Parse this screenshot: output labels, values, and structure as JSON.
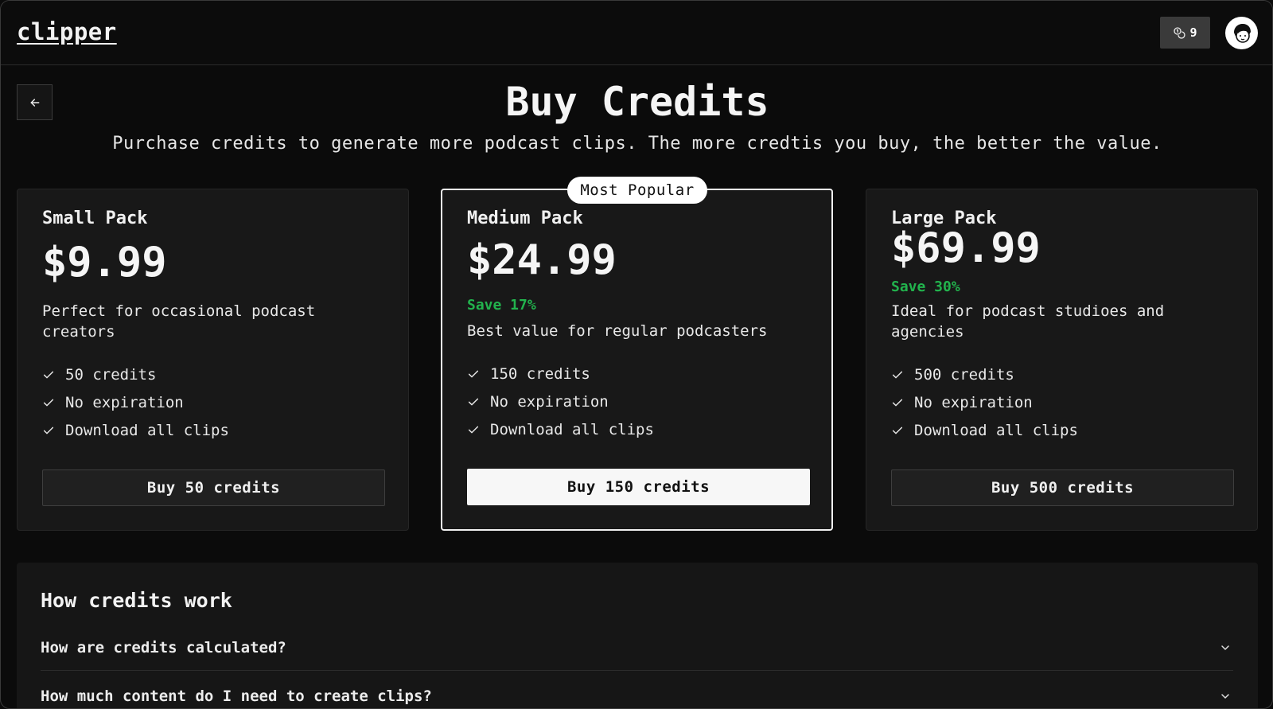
{
  "header": {
    "logo": "clipper",
    "credits_count": "9",
    "credits_icon": "coins-icon",
    "avatar_icon": "user-avatar"
  },
  "back_icon": "arrow-left-icon",
  "page": {
    "title": "Buy Credits",
    "subtitle": "Purchase credits to generate more podcast clips. The more credtis you buy, the better the value."
  },
  "plans": [
    {
      "name": "Small Pack",
      "price": "$9.99",
      "save": "",
      "description": "Perfect for occasional podcast creators",
      "features": [
        "50 credits",
        "No expiration",
        "Download all clips"
      ],
      "button": "Buy 50 credits"
    },
    {
      "badge": "Most Popular",
      "name": "Medium Pack",
      "price": "$24.99",
      "save": "Save 17%",
      "description": "Best value for regular podcasters",
      "features": [
        "150 credits",
        "No expiration",
        "Download all clips"
      ],
      "button": "Buy 150 credits"
    },
    {
      "name": "Large Pack",
      "price": "$69.99",
      "save": "Save 30%",
      "description": "Ideal for podcast studioes and agencies",
      "features": [
        "500 credits",
        "No expiration",
        "Download all clips"
      ],
      "button": "Buy 500 credits"
    }
  ],
  "faq": {
    "title": "How credits work",
    "items": [
      "How are credits calculated?",
      "How much content do I need to create clips?"
    ]
  },
  "colors": {
    "accent_save": "#22b34d",
    "background": "#0b0b0b",
    "card": "#181818"
  }
}
